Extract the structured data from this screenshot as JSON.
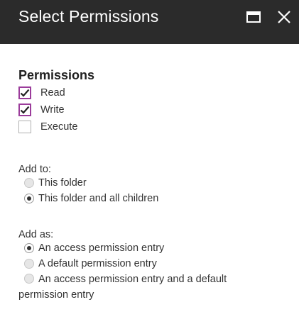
{
  "window": {
    "title": "Select Permissions"
  },
  "permissions": {
    "heading": "Permissions",
    "items": [
      {
        "label": "Read",
        "checked": true
      },
      {
        "label": "Write",
        "checked": true
      },
      {
        "label": "Execute",
        "checked": false
      }
    ]
  },
  "add_to": {
    "label": "Add to:",
    "options": [
      {
        "label": "This folder",
        "selected": false
      },
      {
        "label": "This folder and all children",
        "selected": true
      }
    ]
  },
  "add_as": {
    "label": "Add as:",
    "options": [
      {
        "label": "An access permission entry",
        "selected": true
      },
      {
        "label": "A default permission entry",
        "selected": false
      },
      {
        "label": "An access permission entry and a default",
        "label_cont": "permission entry",
        "selected": false
      }
    ]
  },
  "colors": {
    "titlebar": "#2b2b2b",
    "checkbox_accent": "#9b3c9b"
  },
  "icons": {
    "maximize": "maximize-icon",
    "close": "close-icon",
    "check": "checkmark-icon"
  }
}
